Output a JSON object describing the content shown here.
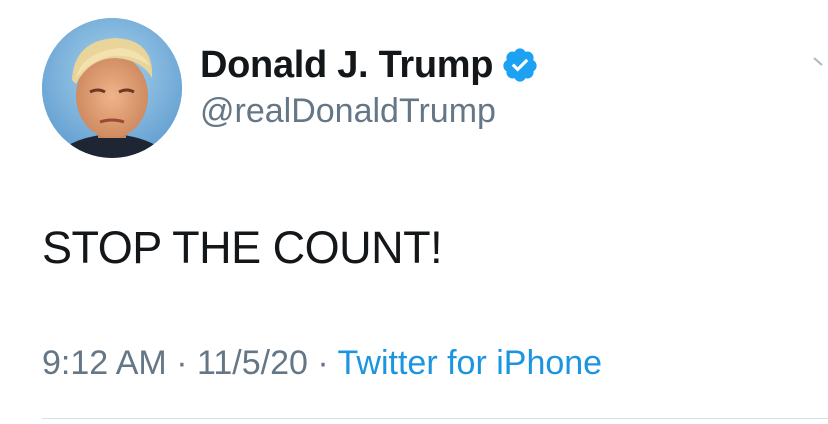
{
  "tweet": {
    "display_name": "Donald J. Trump",
    "handle": "@realDonaldTrump",
    "verified": true,
    "text": "STOP THE COUNT!",
    "time": "9:12 AM",
    "separator": "·",
    "date": "11/5/20",
    "source": "Twitter for iPhone"
  },
  "colors": {
    "accent": "#1da1f2",
    "text": "#14171a",
    "muted": "#657786",
    "source_link": "#1b95e0"
  },
  "icons": {
    "verified": "verified-badge-icon",
    "menu": "chevron-down-icon",
    "avatar": "profile-photo"
  }
}
